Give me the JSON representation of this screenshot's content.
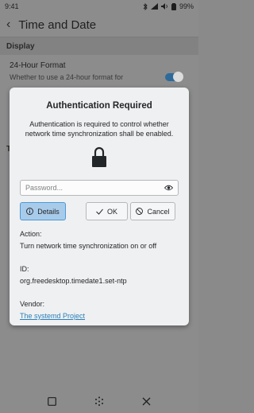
{
  "status_bar": {
    "time": "9:41",
    "battery": "99%"
  },
  "app": {
    "title": "Time and Date",
    "section_display": "Display",
    "setting_title": "24-Hour Format",
    "setting_desc": "Whether to use a 24-hour format for",
    "section_2": "T"
  },
  "dialog": {
    "title": "Authentication Required",
    "message": "Authentication is required to control whether network time synchronization shall be enabled.",
    "password_placeholder": "Password...",
    "details_label": "Details",
    "ok_label": "OK",
    "cancel_label": "Cancel",
    "action_label": "Action:",
    "action_value": "Turn network time synchronization on or off",
    "id_label": "ID:",
    "id_value": "org.freedesktop.timedate1.set-ntp",
    "vendor_label": "Vendor:",
    "vendor_value": "The systemd Project"
  },
  "colors": {
    "accent": "#3daee9",
    "link": "#2980b9",
    "details_bg": "#a9cbea"
  }
}
